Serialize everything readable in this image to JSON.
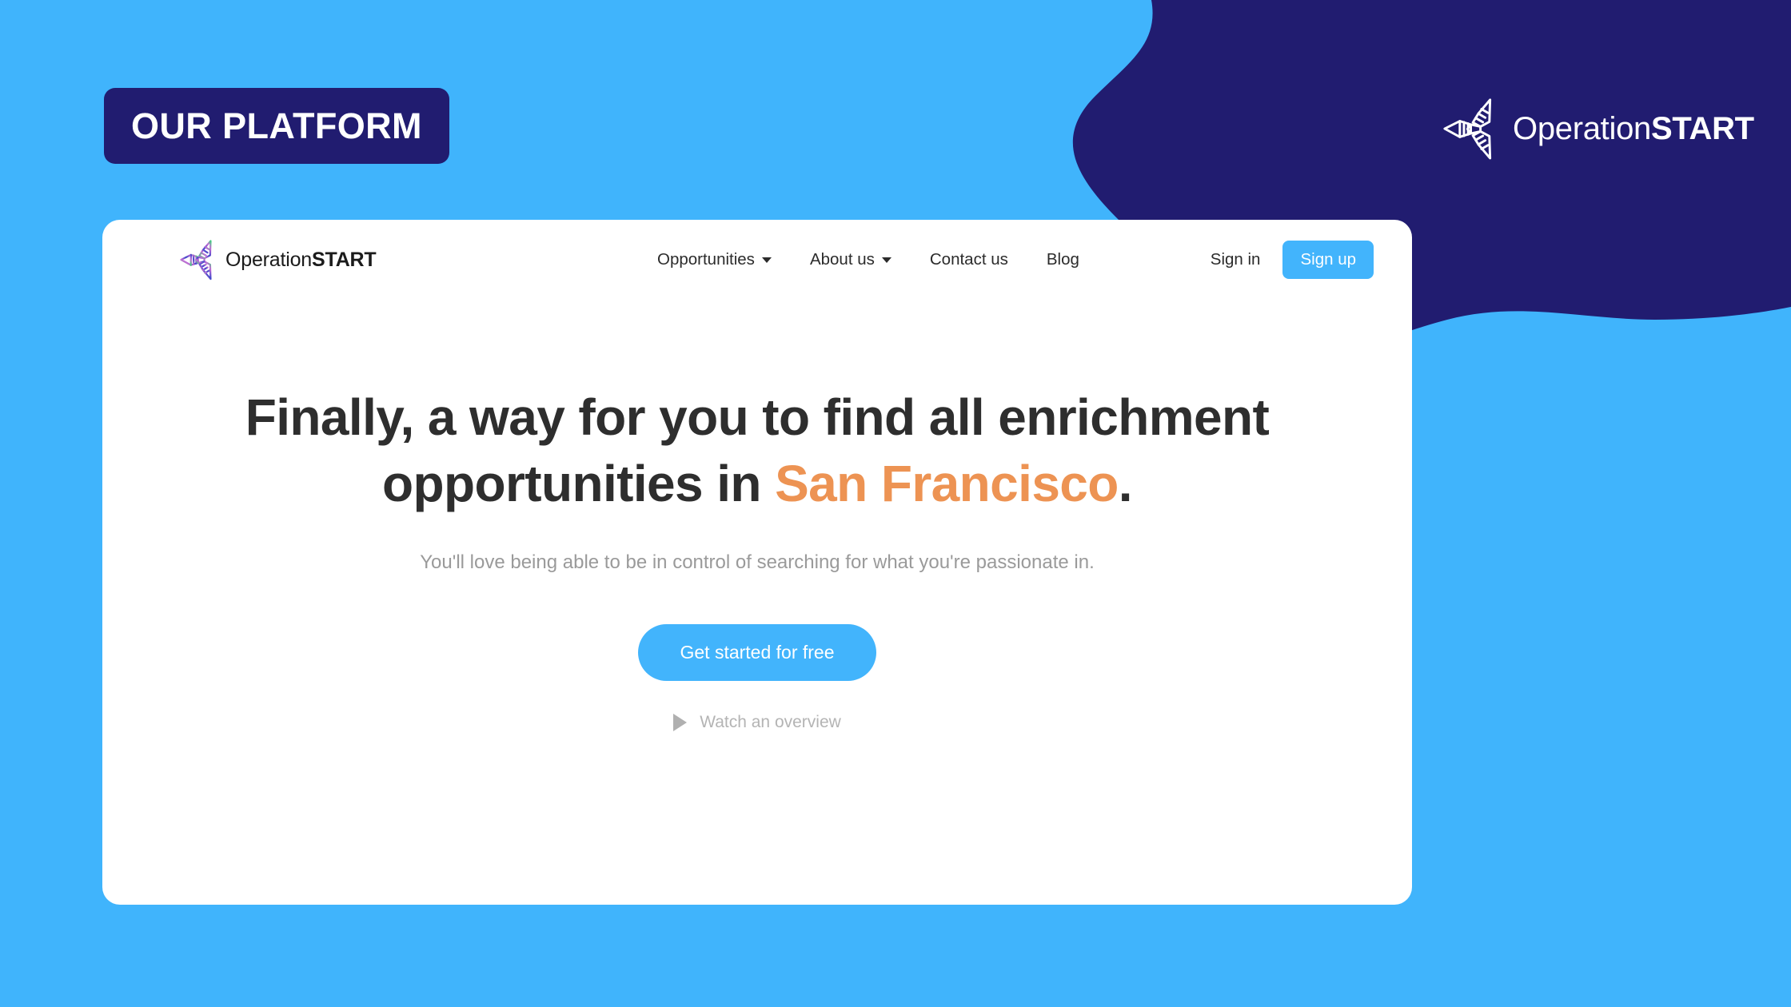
{
  "theme": {
    "page_background": "#40B4FC",
    "navy": "#211C70",
    "accent_blue": "#42B4FC",
    "accent_orange": "#ED9353",
    "card_background": "#FFFFFF",
    "heading_color": "#2E2E2E",
    "muted_text": "#9A9A9A"
  },
  "platform_badge": {
    "label": "OUR PLATFORM"
  },
  "brand_topright": {
    "mark_icon": "operationstart-pinwheel-logo-icon",
    "name_light": "Operation",
    "name_bold": "START"
  },
  "navbar": {
    "brand": {
      "mark_icon": "operationstart-pinwheel-logo-icon",
      "name_light": "Operation",
      "name_bold": "START"
    },
    "links": [
      {
        "label": "Opportunities",
        "has_dropdown": true,
        "icon": "chevron-down-icon"
      },
      {
        "label": "About us",
        "has_dropdown": true,
        "icon": "chevron-down-icon"
      },
      {
        "label": "Contact us",
        "has_dropdown": false,
        "icon": ""
      },
      {
        "label": "Blog",
        "has_dropdown": false,
        "icon": ""
      }
    ],
    "sign_in_label": "Sign in",
    "sign_up_label": "Sign up"
  },
  "hero": {
    "heading_line1": "Finally, a way for you to find all enrichment",
    "heading_line2_prefix": "opportunities in ",
    "heading_highlight": "San Francisco",
    "heading_suffix": ".",
    "subheading": "You'll love being able to be in control of searching for what you're passionate in.",
    "cta_label": "Get started for free",
    "watch_label": "Watch an overview",
    "watch_icon": "play-triangle-icon"
  }
}
